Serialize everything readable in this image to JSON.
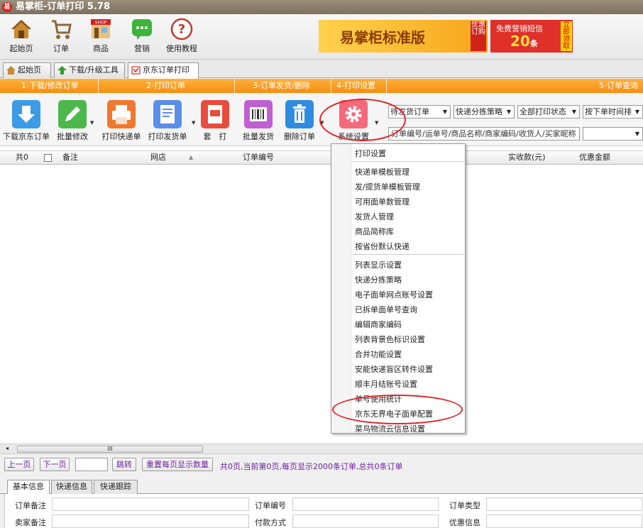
{
  "window": {
    "title": "易掌柜-订单打印 5.78",
    "logo_char": "易"
  },
  "topbar": {
    "buttons": [
      {
        "label": "起始页",
        "icon": "house-icon"
      },
      {
        "label": "订单",
        "icon": "cart-icon"
      },
      {
        "label": "商品",
        "icon": "shop-icon"
      },
      {
        "label": "营销",
        "icon": "chat-icon"
      },
      {
        "label": "使用教程",
        "icon": "help-icon"
      }
    ],
    "shop_sign": "SHOP",
    "ad_edition": {
      "text": "易掌柜标准版",
      "tag": "优惠订购"
    },
    "ad_sms": {
      "line1": "免费营销短信",
      "count": "20",
      "unit": "条",
      "tag": "立即领取"
    }
  },
  "tabs": [
    "起始页",
    "下载/升级工具",
    "京东订单打印"
  ],
  "steps": [
    "1-下载/修改订单",
    "2-打印订单",
    "3-订单发货/删除",
    "4-打印设置",
    "5-订单查询"
  ],
  "toolbar": {
    "buttons": [
      "下载京东订单",
      "批量修改",
      "打印快递单",
      "打印发货单",
      "套　打",
      "批量发货",
      "删除订单",
      "系统设置"
    ],
    "filters": [
      "待发货订单",
      "快递分拣策略",
      "全部打印状态",
      "按下单时间排序"
    ],
    "search_placeholder": "订单编号/运单号/商品名称/商家编码/收货人/买家昵称",
    "search_combo": ""
  },
  "grid": {
    "columns": [
      "共0",
      "备注",
      "网店",
      "订单编号",
      "实收款(元)",
      "优惠金额"
    ],
    "scroll_label": "III"
  },
  "menu": {
    "items": [
      "打印设置",
      "快递单模板管理",
      "发/提货单模板管理",
      "可用面单数管理",
      "发货人管理",
      "商品简称库",
      "按省份默认快递",
      "列表显示设置",
      "快递分拣策略",
      "电子面单网点账号设置",
      "已拆单面单号查询",
      "编辑商家编码",
      "列表背景色标识设置",
      "合并功能设置",
      "安能快递盲区转件设置",
      "顺丰月结账号设置",
      "单号使用统计",
      "京东无界电子面单配置",
      "菜鸟物流云信息设置"
    ]
  },
  "pager": {
    "prev": "上一页",
    "next": "下一页",
    "page_value": "",
    "jump": "跳转",
    "reset": "重置每页显示数量",
    "info": "共0页,当前第0页,每页显示2000条订单,总共0条订单"
  },
  "bottom_tabs": [
    "基本信息",
    "快递信息",
    "快递跟踪"
  ],
  "info_fields": {
    "order_note": "订单备注",
    "seller_note": "卖家备注",
    "order_no": "订单编号",
    "pay_method": "付款方式",
    "order_type": "订单类型",
    "discount_info": "优惠信息"
  },
  "colors": {
    "accent_orange": "#f48e14",
    "highlight_red": "#e0252b",
    "link_purple": "#6b1fa0"
  }
}
